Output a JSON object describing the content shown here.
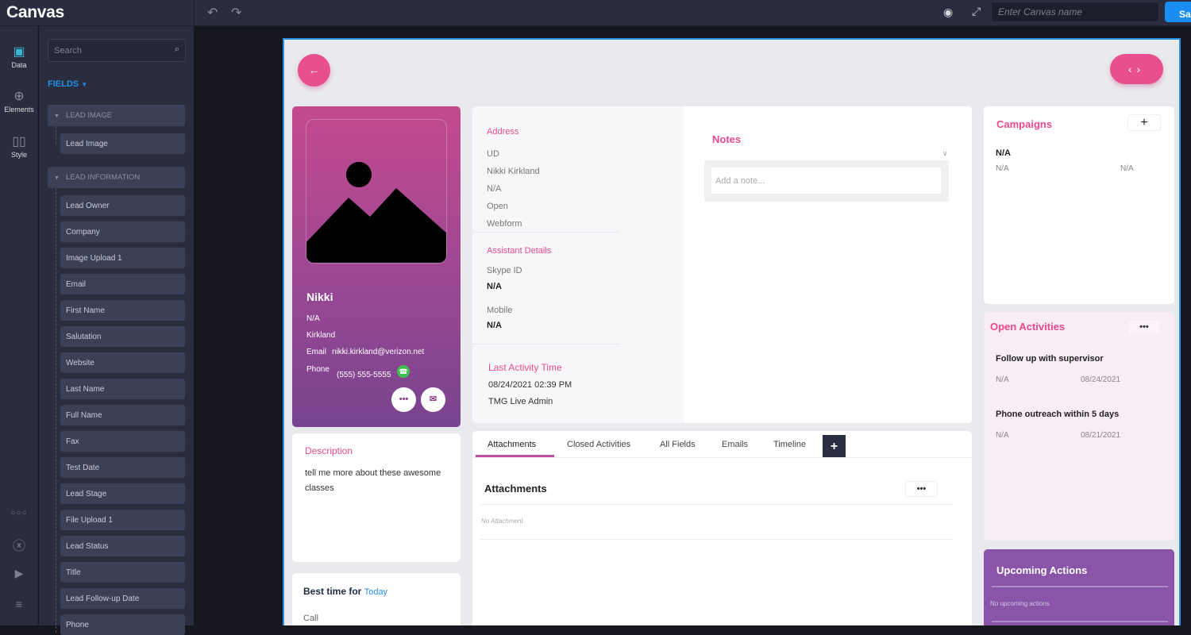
{
  "app": {
    "logo": "Canvas",
    "canvas_name_placeholder": "Enter Canvas name",
    "canvas_name_value": "",
    "save_label": "Save",
    "icons": {
      "undo": "undo-icon",
      "redo": "redo-icon",
      "preview": "eye-icon",
      "fullscreen": "expand-icon"
    }
  },
  "rail": {
    "items": [
      {
        "label": "Data",
        "icon": "data-icon",
        "active": true
      },
      {
        "label": "Elements",
        "icon": "plus-circle-icon"
      },
      {
        "label": "Style",
        "icon": "style-icon"
      }
    ],
    "bottom_icons": [
      "more-icon",
      "help-icon",
      "video-icon",
      "list-icon"
    ]
  },
  "panel": {
    "search_placeholder": "Search",
    "fields_label": "FIELDS",
    "groups": [
      {
        "label": "LEAD IMAGE",
        "fields": [
          "Lead Image"
        ]
      },
      {
        "label": "LEAD INFORMATION",
        "fields": [
          "Lead Owner",
          "Company",
          "Image Upload 1",
          "Email",
          "First Name",
          "Salutation",
          "Website",
          "Last Name",
          "Full Name",
          "Fax",
          "Test Date",
          "Lead Stage",
          "File Upload 1",
          "Lead Status",
          "Title",
          "Lead Follow-up Date",
          "Phone"
        ]
      }
    ]
  },
  "profile": {
    "name": "Nikki",
    "line1": "N/A",
    "line2": "Kirkland",
    "email_label": "Email",
    "email": "nikki.kirkland@verizon.net",
    "phone_label": "Phone",
    "phone": "(555) 555-5555",
    "more_glyph": "•••",
    "mail_glyph": "✉"
  },
  "details": {
    "address_title": "Address",
    "address_lines": [
      "UD",
      "Nikki Kirkland",
      "N/A",
      "Open",
      "Webform"
    ],
    "assistant_title": "Assistant Details",
    "skype_label": "Skype ID",
    "skype_value": "N/A",
    "mobile_label": "Mobile",
    "mobile_value": "N/A",
    "last_activity_title": "Last Activity Time",
    "last_activity_time": "08/24/2021 02:39 PM",
    "last_activity_user": "TMG Live Admin"
  },
  "notes": {
    "title": "Notes",
    "placeholder": "Add a note..."
  },
  "description": {
    "title": "Description",
    "text": "tell me more about these awesome classes"
  },
  "best_time": {
    "title": "Best time for",
    "link": "Today",
    "item": "Call"
  },
  "tabs": {
    "items": [
      "Attachments",
      "Closed Activities",
      "All Fields",
      "Emails",
      "Timeline"
    ],
    "active": "Attachments",
    "add_glyph": "+",
    "section_title": "Attachments",
    "empty": "No Attachment",
    "more_glyph": "•••"
  },
  "campaigns": {
    "title": "Campaigns",
    "add_glyph": "+",
    "name": "N/A",
    "col1": "N/A",
    "col2": "N/A"
  },
  "open_activities": {
    "title": "Open Activities",
    "more_glyph": "•••",
    "items": [
      {
        "title": "Follow up with supervisor",
        "owner": "N/A",
        "date": "08/24/2021"
      },
      {
        "title": "Phone outreach within 5 days",
        "owner": "N/A",
        "date": "08/21/2021"
      }
    ]
  },
  "upcoming": {
    "title": "Upcoming Actions",
    "empty": "No upcoming actions"
  },
  "colors": {
    "accent_pink": "#e84f8d",
    "accent_blue": "#1a8df0",
    "purple": "#8a54a8"
  }
}
